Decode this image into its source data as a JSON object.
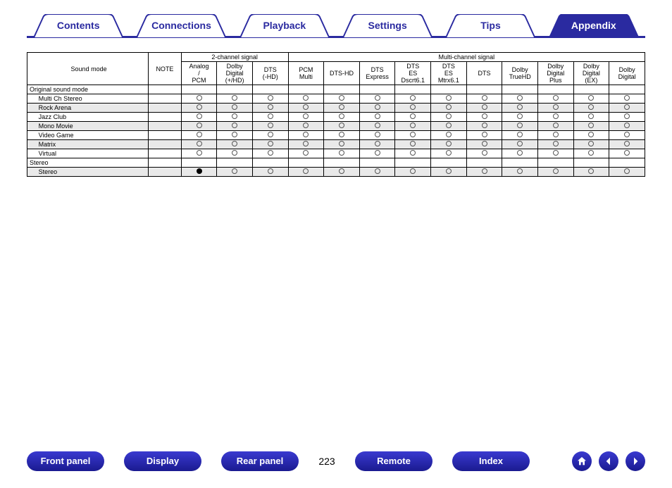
{
  "nav": {
    "tabs": [
      {
        "label": "Contents",
        "active": false
      },
      {
        "label": "Connections",
        "active": false
      },
      {
        "label": "Playback",
        "active": false
      },
      {
        "label": "Settings",
        "active": false
      },
      {
        "label": "Tips",
        "active": false
      },
      {
        "label": "Appendix",
        "active": true
      }
    ]
  },
  "table": {
    "head": {
      "soundMode": "Sound mode",
      "note": "NOTE",
      "twoCh": "2-channel signal",
      "multiCh": "Multi-channel signal",
      "cols2": [
        "Analog / PCM",
        "Dolby Digital (+/HD)",
        "DTS (-HD)"
      ],
      "colsM": [
        "PCM Multi",
        "DTS-HD",
        "DTS Express",
        "DTS ES Dscrt6.1",
        "DTS ES Mtrx6.1",
        "DTS",
        "Dolby TrueHD",
        "Dolby Digital Plus",
        "Dolby Digital (EX)",
        "Dolby Digital"
      ]
    },
    "groups": [
      {
        "title": "Original sound mode",
        "rows": [
          {
            "name": "Multi Ch Stereo",
            "note": "",
            "marks": [
              "o",
              "o",
              "o",
              "o",
              "o",
              "o",
              "o",
              "o",
              "o",
              "o",
              "o",
              "o",
              "o"
            ]
          },
          {
            "name": "Rock Arena",
            "note": "",
            "marks": [
              "o",
              "o",
              "o",
              "o",
              "o",
              "o",
              "o",
              "o",
              "o",
              "o",
              "o",
              "o",
              "o"
            ]
          },
          {
            "name": "Jazz Club",
            "note": "",
            "marks": [
              "o",
              "o",
              "o",
              "o",
              "o",
              "o",
              "o",
              "o",
              "o",
              "o",
              "o",
              "o",
              "o"
            ]
          },
          {
            "name": "Mono Movie",
            "note": "",
            "marks": [
              "o",
              "o",
              "o",
              "o",
              "o",
              "o",
              "o",
              "o",
              "o",
              "o",
              "o",
              "o",
              "o"
            ]
          },
          {
            "name": "Video Game",
            "note": "",
            "marks": [
              "o",
              "o",
              "o",
              "o",
              "o",
              "o",
              "o",
              "o",
              "o",
              "o",
              "o",
              "o",
              "o"
            ]
          },
          {
            "name": "Matrix",
            "note": "",
            "marks": [
              "o",
              "o",
              "o",
              "o",
              "o",
              "o",
              "o",
              "o",
              "o",
              "o",
              "o",
              "o",
              "o"
            ]
          },
          {
            "name": "Virtual",
            "note": "",
            "marks": [
              "o",
              "o",
              "o",
              "o",
              "o",
              "o",
              "o",
              "o",
              "o",
              "o",
              "o",
              "o",
              "o"
            ]
          }
        ]
      },
      {
        "title": "Stereo",
        "rows": [
          {
            "name": "Stereo",
            "note": "",
            "marks": [
              "d",
              "o",
              "o",
              "o",
              "o",
              "o",
              "o",
              "o",
              "o",
              "o",
              "o",
              "o",
              "o"
            ]
          }
        ]
      }
    ]
  },
  "bottom": {
    "buttons": [
      "Front panel",
      "Display",
      "Rear panel"
    ],
    "page": "223",
    "buttons2": [
      "Remote",
      "Index"
    ]
  },
  "colors": {
    "brand": "#2a2aa0"
  }
}
